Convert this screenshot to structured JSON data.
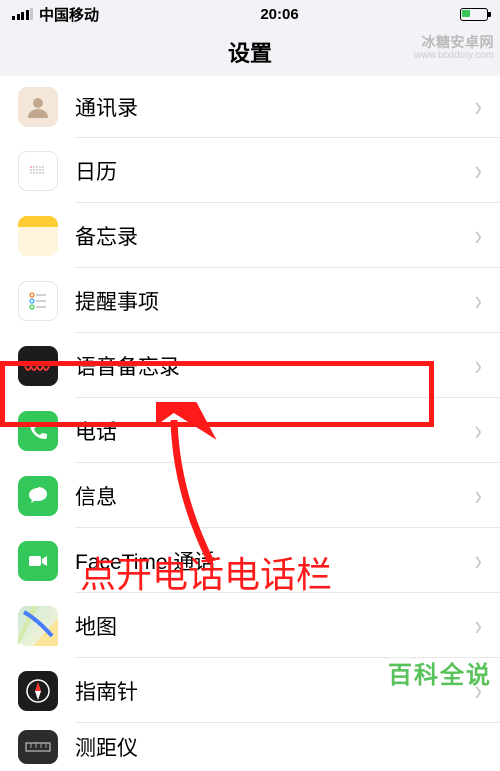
{
  "status": {
    "carrier": "中国移动",
    "time": "20:06"
  },
  "header": {
    "title": "设置"
  },
  "rows": [
    {
      "label": "通讯录"
    },
    {
      "label": "日历"
    },
    {
      "label": "备忘录"
    },
    {
      "label": "提醒事项"
    },
    {
      "label": "语音备忘录"
    },
    {
      "label": "电话"
    },
    {
      "label": "信息"
    },
    {
      "label": "FaceTime 通话"
    },
    {
      "label": "地图"
    },
    {
      "label": "指南针"
    },
    {
      "label": "测距仪"
    }
  ],
  "annotation_text": "点开电话电话栏",
  "watermark_top": "冰糖安卓网",
  "watermark_top_sub": "www.btxtdmy.com",
  "watermark_bot": "百科全说"
}
